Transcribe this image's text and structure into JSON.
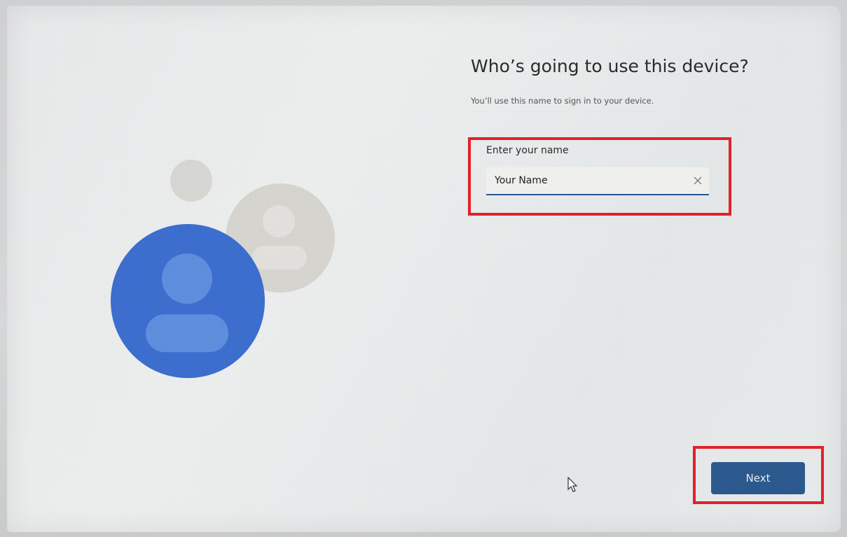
{
  "page": {
    "title": "Who’s going to use this device?",
    "subtitle": "You’ll use this name to sign in to your device."
  },
  "name_field": {
    "label": "Enter your name",
    "value": "Your Name"
  },
  "actions": {
    "next_label": "Next"
  },
  "icons": {
    "clear": "close-icon",
    "avatar_primary": "user-avatar-icon",
    "avatar_secondary": "user-avatar-icon",
    "pointer": "mouse-cursor-icon"
  },
  "colors": {
    "accent": "#2c5a8f",
    "avatar_blue": "#3d6fd0",
    "highlight": "#e3222c"
  }
}
